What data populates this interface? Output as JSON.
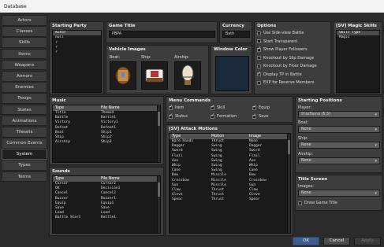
{
  "window": {
    "title": "Database"
  },
  "sidebar": {
    "items": [
      "Actors",
      "Classes",
      "Skills",
      "Items",
      "Weapons",
      "Armors",
      "Enemies",
      "Troops",
      "States",
      "Animations",
      "Tilesets",
      "Common Events",
      "System",
      "Types",
      "Terms"
    ],
    "active_index": 12
  },
  "starting_party": {
    "title": "Starting Party",
    "items": [
      "Actor",
      "null",
      "?",
      "?",
      "?"
    ]
  },
  "game_title": {
    "title": "Game Title",
    "value": "PBPA"
  },
  "currency": {
    "title": "Currency",
    "value": "Bath"
  },
  "vehicle_images": {
    "title": "Vehicle Images",
    "boat": "Boat:",
    "ship": "Ship:",
    "airship": "Airship:"
  },
  "window_color": {
    "title": "Window Color"
  },
  "options": {
    "title": "Options",
    "items": [
      {
        "label": "Use Side-view Battle",
        "checked": false
      },
      {
        "label": "Start Transparent",
        "checked": false
      },
      {
        "label": "Show Player Followers",
        "checked": true
      },
      {
        "label": "Knockout by Slip Damage",
        "checked": false
      },
      {
        "label": "Knockout by Floor Damage",
        "checked": false
      },
      {
        "label": "Display TP in Battle",
        "checked": true
      },
      {
        "label": "EXP for Reserve Members",
        "checked": false
      }
    ]
  },
  "magic_skills": {
    "title": "[SV] Magic Skills",
    "items": [
      "Skill Type",
      "Magic"
    ]
  },
  "music": {
    "title": "Music",
    "headers": [
      "Type",
      "File Name"
    ],
    "rows": [
      [
        "Title",
        "Theme4"
      ],
      [
        "Battle",
        "Battle1"
      ],
      [
        "Victory",
        "Victory1"
      ],
      [
        "Defeat",
        "Defeat1"
      ],
      [
        "Boat",
        "Ship1"
      ],
      [
        "Ship",
        "Ship2"
      ],
      [
        "Airship",
        "Ship3"
      ]
    ]
  },
  "sounds": {
    "title": "Sounds",
    "headers": [
      "Type",
      "File Name"
    ],
    "rows": [
      [
        "Cursor",
        "Cursor2"
      ],
      [
        "OK",
        "Decision1"
      ],
      [
        "Cancel",
        "Cancel2"
      ],
      [
        "Buzzer",
        "Buzzer1"
      ],
      [
        "Equip",
        "Equip1"
      ],
      [
        "Save",
        "Save"
      ],
      [
        "Load",
        "Load"
      ],
      [
        "Battle Start",
        "Battle1"
      ]
    ]
  },
  "menu_commands": {
    "title": "Menu Commands",
    "items": [
      {
        "label": "Item",
        "checked": true
      },
      {
        "label": "Skill",
        "checked": true
      },
      {
        "label": "Equip",
        "checked": true
      },
      {
        "label": "Status",
        "checked": true
      },
      {
        "label": "Formation",
        "checked": true
      },
      {
        "label": "Save",
        "checked": true
      }
    ]
  },
  "attack_motions": {
    "title": "[SV] Attack Motions",
    "headers": [
      "Type",
      "Motion",
      "Image"
    ],
    "rows": [
      [
        "Bare Hands",
        "Thrust",
        "None"
      ],
      [
        "Dagger",
        "Swing",
        "Dagger"
      ],
      [
        "Sword",
        "Swing",
        "Sword"
      ],
      [
        "Flail",
        "Swing",
        "Flail"
      ],
      [
        "Axe",
        "Swing",
        "Axe"
      ],
      [
        "Whip",
        "Swing",
        "Whip"
      ],
      [
        "Cane",
        "Swing",
        "Cane"
      ],
      [
        "Bow",
        "Missile",
        "Bow"
      ],
      [
        "Crossbow",
        "Missile",
        "Crossbow"
      ],
      [
        "Gun",
        "Missile",
        "Gun"
      ],
      [
        "Claw",
        "Thrust",
        "Claw"
      ],
      [
        "Glove",
        "Thrust",
        "Glove"
      ],
      [
        "Spear",
        "Thrust",
        "Spear"
      ]
    ]
  },
  "starting_positions": {
    "title": "Starting Positions",
    "player_label": "Player:",
    "player_value": "บ้านเริ่มเกม (5,5)",
    "boat_label": "Boat:",
    "boat_value": "None",
    "ship_label": "Ship:",
    "ship_value": "None",
    "airship_label": "Airship:",
    "airship_value": "None"
  },
  "title_screen": {
    "title": "Title Screen",
    "images_label": "Images:",
    "images_value": "None",
    "draw_title_label": "Draw Game Title",
    "draw_title_checked": false
  },
  "footer": {
    "ok": "OK",
    "cancel": "Cancel",
    "apply": "Apply"
  }
}
